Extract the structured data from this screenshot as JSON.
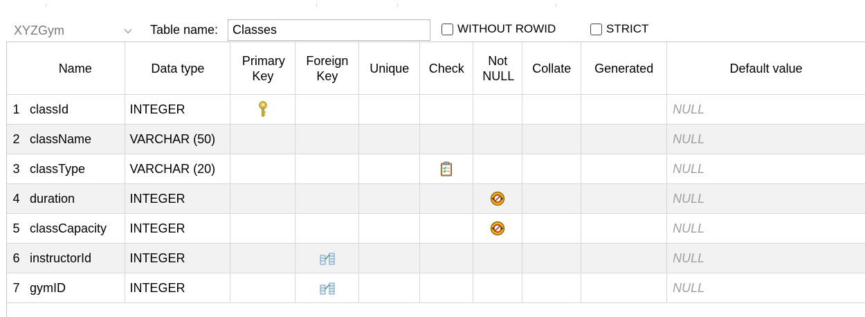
{
  "toolbar": {
    "database": "XYZGym",
    "table_name_label": "Table name:",
    "table_name_value": "Classes",
    "without_rowid_label": "WITHOUT ROWID",
    "strict_label": "STRICT"
  },
  "columns": {
    "name": "Name",
    "data_type": "Data type",
    "primary_key": "Primary Key",
    "foreign_key": "Foreign Key",
    "unique": "Unique",
    "check": "Check",
    "not_null": "Not NULL",
    "collate": "Collate",
    "generated": "Generated",
    "default_value": "Default value"
  },
  "rows": [
    {
      "num": "1",
      "name": "classId",
      "type": "INTEGER",
      "default": "NULL"
    },
    {
      "num": "2",
      "name": "className",
      "type": "VARCHAR (50)",
      "default": "NULL"
    },
    {
      "num": "3",
      "name": "classType",
      "type": "VARCHAR (20)",
      "default": "NULL"
    },
    {
      "num": "4",
      "name": "duration",
      "type": "INTEGER",
      "default": "NULL"
    },
    {
      "num": "5",
      "name": "classCapacity",
      "type": "INTEGER",
      "default": "NULL"
    },
    {
      "num": "6",
      "name": "instructorId",
      "type": "INTEGER",
      "default": "NULL"
    },
    {
      "num": "7",
      "name": "gymID",
      "type": "INTEGER",
      "default": "NULL"
    }
  ],
  "icons": {
    "primary_key": "key-icon",
    "check": "clipboard-check-icon",
    "not_null": "not-null-icon",
    "foreign_key": "foreign-key-icon"
  }
}
